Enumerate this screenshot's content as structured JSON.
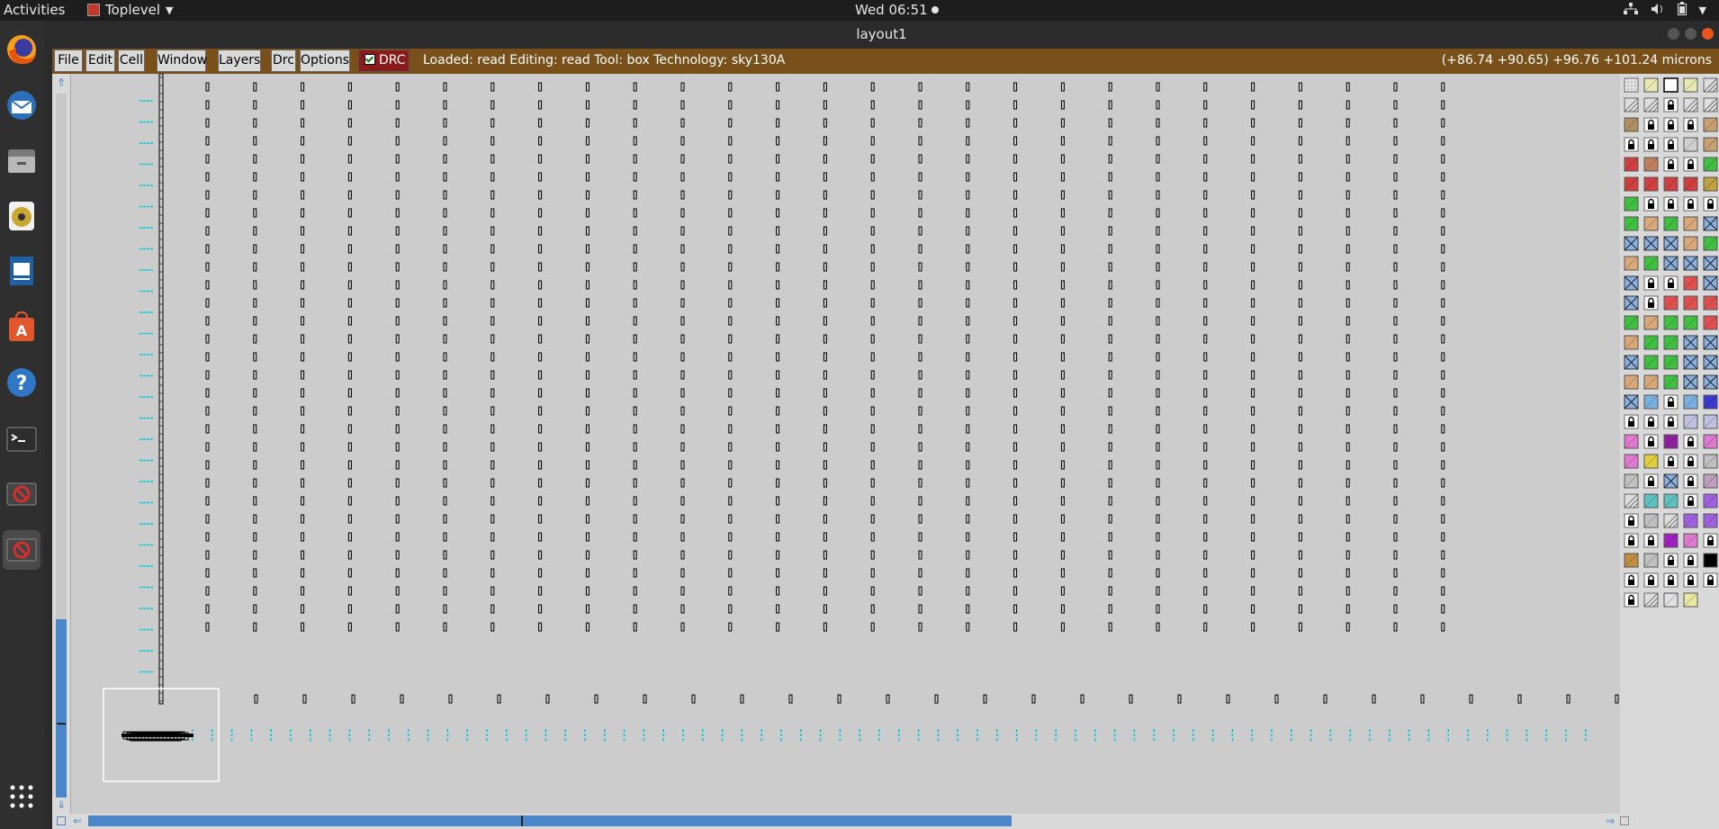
{
  "topbar": {
    "activities": "Activities",
    "app_name": "Toplevel",
    "clock": "Wed 06:51"
  },
  "dock": {
    "items": [
      {
        "name": "firefox-icon",
        "color": "#e66000"
      },
      {
        "name": "thunderbird-icon",
        "color": "#2a6fb8"
      },
      {
        "name": "files-icon",
        "color": "#8a8a8a"
      },
      {
        "name": "rhythmbox-icon",
        "color": "#d8c36a"
      },
      {
        "name": "writer-icon",
        "color": "#1f5fa6"
      },
      {
        "name": "software-icon",
        "color": "#e2572b"
      },
      {
        "name": "help-icon",
        "color": "#2f76c4"
      },
      {
        "name": "terminal-icon",
        "color": "#2d2d2d"
      },
      {
        "name": "tk-app-icon",
        "color": "#c0392b"
      },
      {
        "name": "tk-app-icon",
        "color": "#c0392b"
      },
      {
        "name": "show-apps-icon",
        "color": "#ffffff"
      }
    ]
  },
  "window": {
    "title": "layout1"
  },
  "menubar": {
    "items": [
      "File",
      "Edit",
      "Cell",
      "Window",
      "Layers",
      "Drc",
      "Options"
    ],
    "drc_toggle": "DRC",
    "status": "Loaded: read Editing: read Tool: box  Technology: sky130A",
    "coords": "(+86.74 +90.65) +96.76 +101.24 microns"
  },
  "colors": {
    "menubar_bg": "#7a501a",
    "canvas_bg": "#cccccc",
    "scroll_accent": "#4a86c8",
    "wire_cyan": "#00c8d8"
  },
  "palette": {
    "swatches": [
      "grid",
      "#e8e8b0",
      "frame",
      "#e8e8b0",
      "hatch",
      "hatch",
      "hatch",
      "lock",
      "hatch",
      "hatch",
      "#b09060",
      "lock",
      "lock",
      "lock",
      "#c9a070",
      "lock",
      "lock",
      "lock",
      "#d0d0d0",
      "#c9a070",
      "#d04040",
      "#c08060",
      "lock",
      "lock",
      "#40c040",
      "#d04040",
      "#d04040",
      "#d04040",
      "#d04040",
      "#c0a040",
      "#40c040",
      "lock",
      "lock",
      "lock",
      "lock",
      "#40c040",
      "#d8a878",
      "#40c040",
      "#d8a878",
      "xbox",
      "xbox",
      "xbox",
      "xbox",
      "#d8a878",
      "#40c040",
      "#d8a878",
      "#40c040",
      "xbox",
      "xbox",
      "xbox",
      "xbox",
      "lock",
      "lock",
      "#e05050",
      "xbox",
      "xbox",
      "lock",
      "#e05050",
      "#e05050",
      "#e05050",
      "#40c040",
      "#d8a878",
      "#40c040",
      "#40c040",
      "#e05050",
      "#d8a878",
      "#40c040",
      "#40c040",
      "xbox",
      "xbox",
      "xbox",
      "#40c040",
      "#40c040",
      "xbox",
      "xbox",
      "#d8a878",
      "#d8a878",
      "#40c040",
      "xbox",
      "xbox",
      "xbox",
      "#7ab0e0",
      "lock",
      "#7ab0e0",
      "#3a3ad0",
      "lock",
      "lock",
      "lock",
      "#c0c0e0",
      "#c0c0e0",
      "#e07ad0",
      "lock",
      "#9020a0",
      "lock",
      "#e07ad0",
      "#e07ad0",
      "#e0d040",
      "lock",
      "lock",
      "#c0c0c0",
      "#c0c0c0",
      "lock",
      "xbox",
      "lock",
      "#c0a0c0",
      "hatch",
      "#60c0c0",
      "#60c0c0",
      "lock",
      "#a060e0",
      "lock",
      "#c0c0c0",
      "hatch",
      "#a060e0",
      "#a060e0",
      "lock",
      "lock",
      "#a020c0",
      "#e07ad0",
      "lock",
      "#c09040",
      "#c0c0c0",
      "lock",
      "lock",
      "#000000",
      "lock",
      "lock",
      "lock",
      "lock",
      "lock",
      "lock",
      "hatch",
      "#e0e0e0",
      "#e8e8a0"
    ]
  }
}
